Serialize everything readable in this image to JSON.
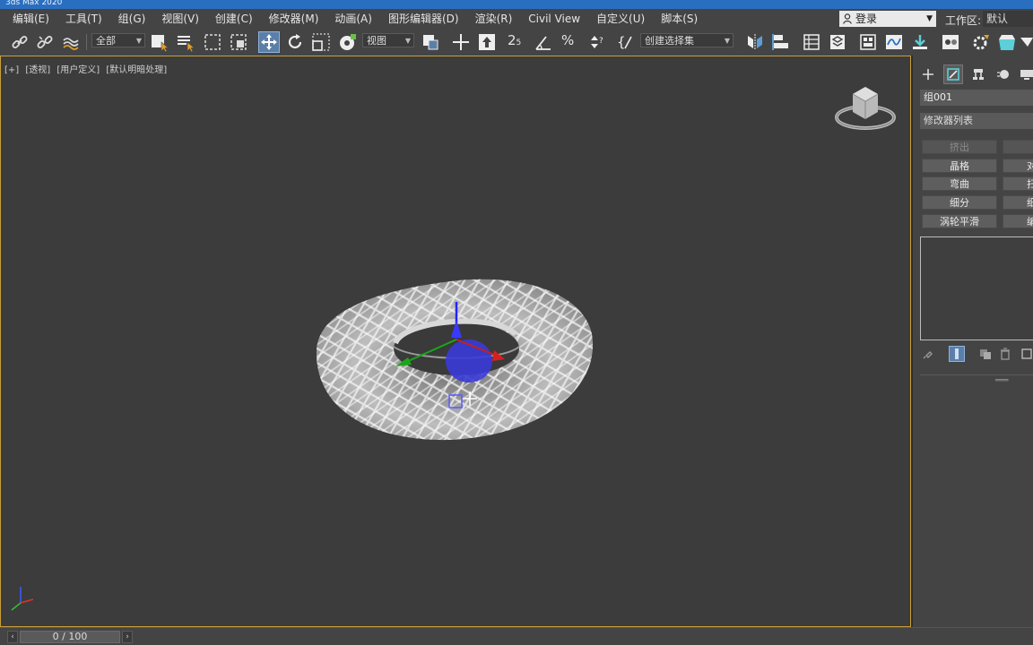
{
  "window": {
    "title": "3ds Max 2020"
  },
  "menu": {
    "items": [
      "编辑(E)",
      "工具(T)",
      "组(G)",
      "视图(V)",
      "创建(C)",
      "修改器(M)",
      "动画(A)",
      "图形编辑器(D)",
      "渲染(R)",
      "Civil View",
      "自定义(U)",
      "脚本(S)"
    ],
    "login_label": "登录",
    "workspace_label": "工作区:",
    "workspace_value": "默认"
  },
  "toolbar": {
    "selection_filter": "全部",
    "ref_coord": "视图",
    "snap_label": "2",
    "snap_sub": "5",
    "percent_label": "%",
    "named_selection": "创建选择集"
  },
  "viewport": {
    "label_plus": "[+]",
    "label_view": "[透视]",
    "label_mode": "[用户定义]",
    "label_shading": "[默认明暗处理]"
  },
  "command_panel": {
    "object_name": "组001",
    "modifier_list": "修改器列表",
    "buttons": [
      "挤出",
      "晶格",
      "弯曲",
      "细分",
      "涡轮平滑"
    ],
    "buttons_right": [
      "",
      "对",
      "扫",
      "细",
      "编辑"
    ]
  },
  "timeline": {
    "frame_display": "0 / 100"
  },
  "colors": {
    "accent": "#5c7fa8",
    "viewport_border": "#c8a03a",
    "background": "#444444"
  },
  "icons": [
    "link-icon",
    "unlink-icon",
    "bind-space-warp-icon",
    "select-object-icon",
    "select-by-name-icon",
    "rect-selection-icon",
    "window-crossing-icon",
    "move-icon",
    "rotate-icon",
    "scale-icon",
    "placement-icon",
    "pivot-icon",
    "snap-icon",
    "angle-snap-icon",
    "percent-snap-icon",
    "spinner-snap-icon",
    "edit-named-sel-icon",
    "mirror-icon",
    "align-icon",
    "scene-explorer-icon",
    "layer-explorer-icon",
    "ribbon-icon",
    "curve-editor-icon",
    "schematic-view-icon",
    "material-editor-icon",
    "render-setup-icon",
    "render-frame-icon",
    "render-icon"
  ]
}
